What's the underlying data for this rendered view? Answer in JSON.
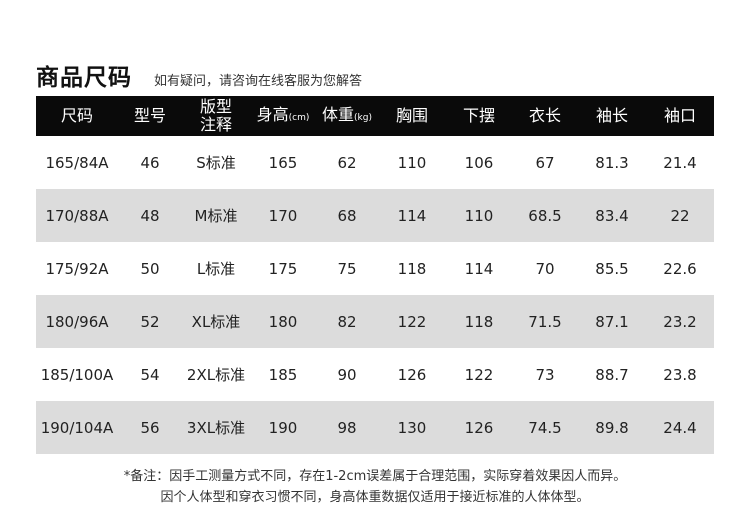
{
  "header": {
    "title": "商品尺码",
    "subtitle": "如有疑问，请咨询在线客服为您解答"
  },
  "table": {
    "columns": [
      {
        "label": "尺码",
        "unit": ""
      },
      {
        "label": "型号",
        "unit": ""
      },
      {
        "label": "版型注释",
        "line1": "版型",
        "line2": "注释",
        "unit": ""
      },
      {
        "label": "身高",
        "unit": "(cm)"
      },
      {
        "label": "体重",
        "unit": "(kg)"
      },
      {
        "label": "胸围",
        "unit": ""
      },
      {
        "label": "下摆",
        "unit": ""
      },
      {
        "label": "衣长",
        "unit": ""
      },
      {
        "label": "袖长",
        "unit": ""
      },
      {
        "label": "袖口",
        "unit": ""
      }
    ],
    "rows": [
      [
        "165/84A",
        "46",
        "S标准",
        "165",
        "62",
        "110",
        "106",
        "67",
        "81.3",
        "21.4"
      ],
      [
        "170/88A",
        "48",
        "M标准",
        "170",
        "68",
        "114",
        "110",
        "68.5",
        "83.4",
        "22"
      ],
      [
        "175/92A",
        "50",
        "L标准",
        "175",
        "75",
        "118",
        "114",
        "70",
        "85.5",
        "22.6"
      ],
      [
        "180/96A",
        "52",
        "XL标准",
        "180",
        "82",
        "122",
        "118",
        "71.5",
        "87.1",
        "23.2"
      ],
      [
        "185/100A",
        "54",
        "2XL标准",
        "185",
        "90",
        "126",
        "122",
        "73",
        "88.7",
        "23.8"
      ],
      [
        "190/104A",
        "56",
        "3XL标准",
        "190",
        "98",
        "130",
        "126",
        "74.5",
        "89.8",
        "24.4"
      ]
    ]
  },
  "notes": {
    "line1": "*备注：因手工测量方式不同，存在1-2cm误差属于合理范围，实际穿着效果因人而异。",
    "line2": "因个人体型和穿衣习惯不同，身高体重数据仅适用于接近标准的人体体型。"
  }
}
